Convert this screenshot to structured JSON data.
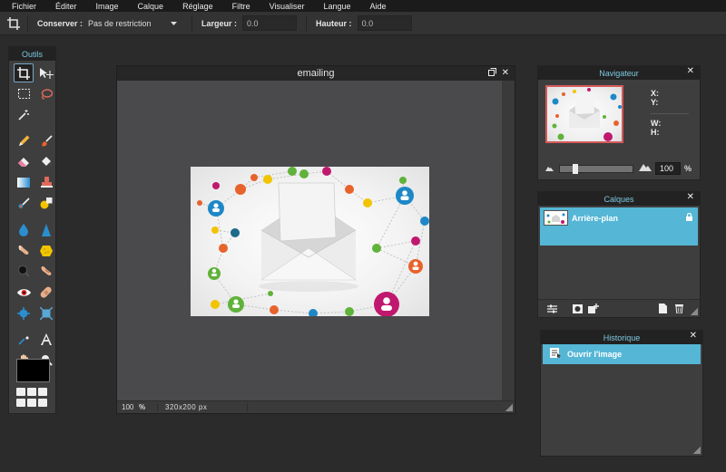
{
  "menubar": {
    "items": [
      "Fichier",
      "Éditer",
      "Image",
      "Calque",
      "Réglage",
      "Filtre",
      "Visualiser",
      "Langue",
      "Aide"
    ]
  },
  "options": {
    "conserver_label": "Conserver :",
    "conserver_value": "Pas de restriction",
    "largeur_label": "Largeur :",
    "largeur_value": "0.0",
    "hauteur_label": "Hauteur :",
    "hauteur_value": "0.0"
  },
  "tools": {
    "title": "Outils",
    "items": [
      {
        "name": "crop-icon",
        "active": true
      },
      {
        "name": "move-icon"
      },
      {
        "name": "marquee-icon"
      },
      {
        "name": "lasso-icon"
      },
      {
        "name": "magic-wand-icon"
      },
      {
        "name": "empty"
      },
      {
        "name": "gap"
      },
      {
        "name": "pencil-icon"
      },
      {
        "name": "brush-icon"
      },
      {
        "name": "eraser-icon"
      },
      {
        "name": "paint-bucket-icon"
      },
      {
        "name": "gradient-icon"
      },
      {
        "name": "clone-stamp-icon"
      },
      {
        "name": "color-replace-icon"
      },
      {
        "name": "drawing-icon"
      },
      {
        "name": "gap"
      },
      {
        "name": "blur-icon"
      },
      {
        "name": "sharpen-icon"
      },
      {
        "name": "smudge-icon"
      },
      {
        "name": "sponge-icon"
      },
      {
        "name": "dodge-icon"
      },
      {
        "name": "burn-icon"
      },
      {
        "name": "red-eye-icon"
      },
      {
        "name": "spot-heal-icon"
      },
      {
        "name": "bloat-icon"
      },
      {
        "name": "pinch-icon"
      },
      {
        "name": "gap"
      },
      {
        "name": "color-picker-icon"
      },
      {
        "name": "text-icon"
      },
      {
        "name": "hand-icon"
      },
      {
        "name": "zoom-icon"
      }
    ]
  },
  "document": {
    "title": "emailing",
    "zoom": "100",
    "zoom_unit": "%",
    "size": "320x200 px"
  },
  "navigator": {
    "title": "Navigateur",
    "x_label": "X:",
    "y_label": "Y:",
    "w_label": "W:",
    "h_label": "H:",
    "zoom_value": "100",
    "zoom_unit": "%",
    "zoom_level": 0.18
  },
  "layers": {
    "title": "Calques",
    "items": [
      {
        "name": "Arrière-plan",
        "locked": true
      }
    ]
  },
  "history": {
    "title": "Historique",
    "items": [
      "Ouvrir l'image"
    ]
  },
  "colors": {
    "accent": "#55b6d6",
    "panel_title": "#7ec8e0",
    "primary_color": "#000000"
  }
}
